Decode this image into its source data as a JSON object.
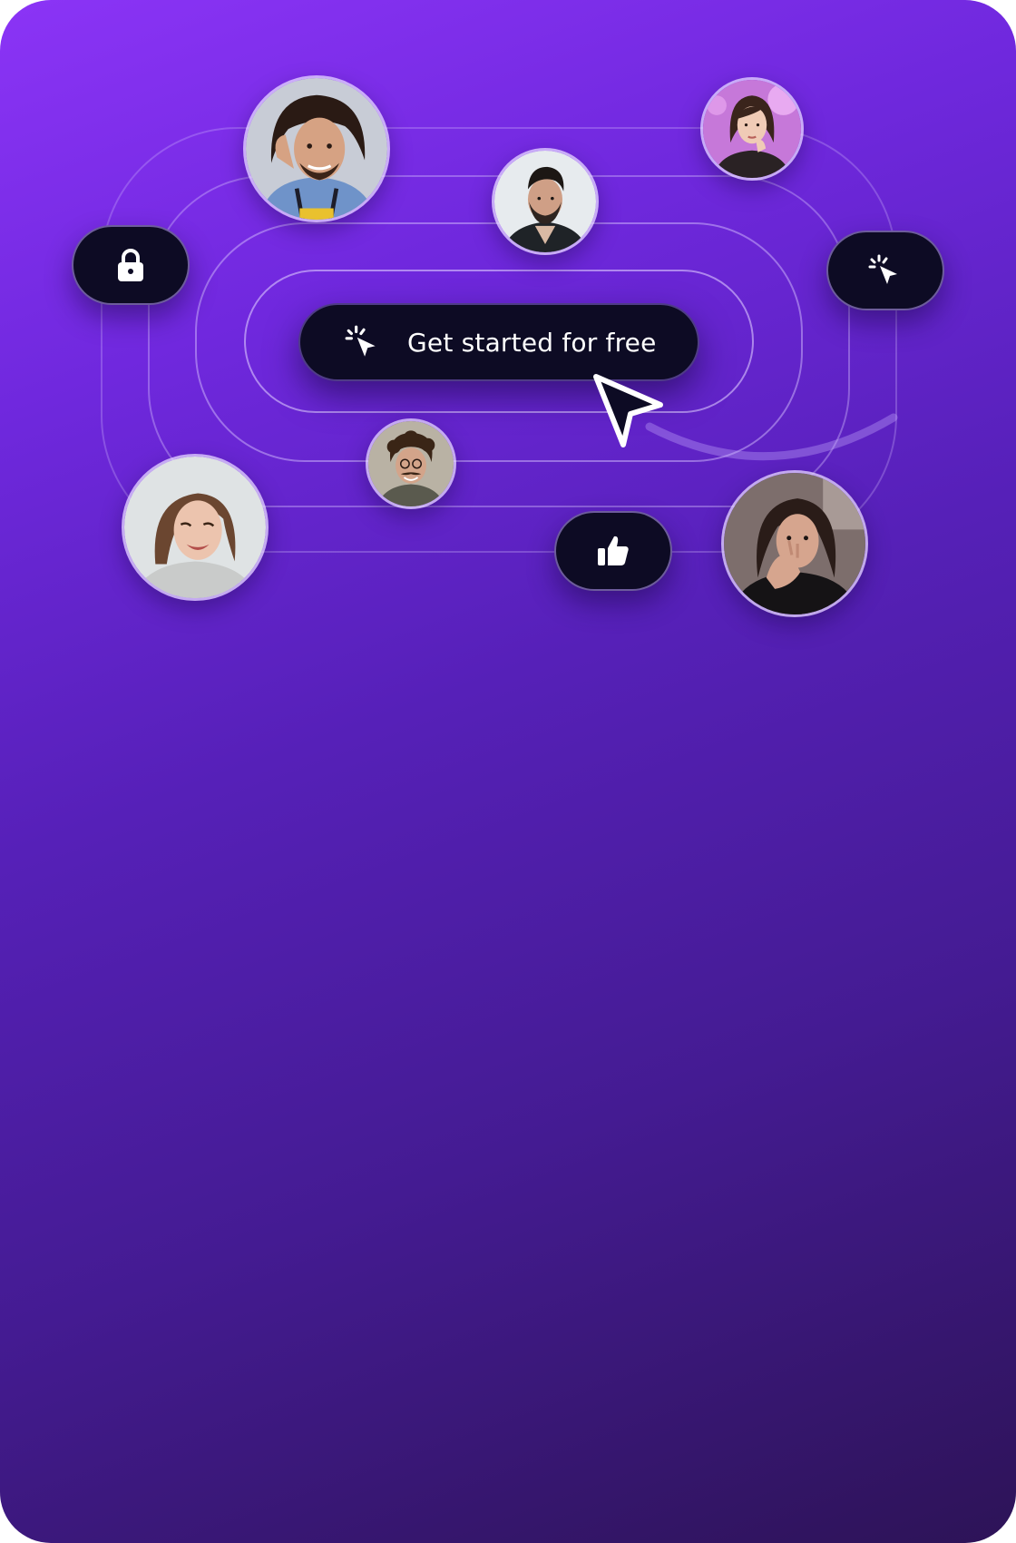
{
  "cta": {
    "label": "Get started for free",
    "icon": "click-cursor-icon"
  },
  "badges": [
    {
      "name": "lock",
      "icon": "lock-icon"
    },
    {
      "name": "click",
      "icon": "click-cursor-icon"
    },
    {
      "name": "like",
      "icon": "thumbs-up-icon"
    }
  ],
  "avatars": [
    {
      "name": "long-haired-man"
    },
    {
      "name": "bearded-man"
    },
    {
      "name": "woman-top-right"
    },
    {
      "name": "curly-haired-man"
    },
    {
      "name": "smiling-woman"
    },
    {
      "name": "woman-bottom-right"
    }
  ],
  "colors": {
    "background_start": "#8b34f6",
    "background_end": "#2d1357",
    "button": "#0d0b24",
    "text": "#ffffff"
  }
}
